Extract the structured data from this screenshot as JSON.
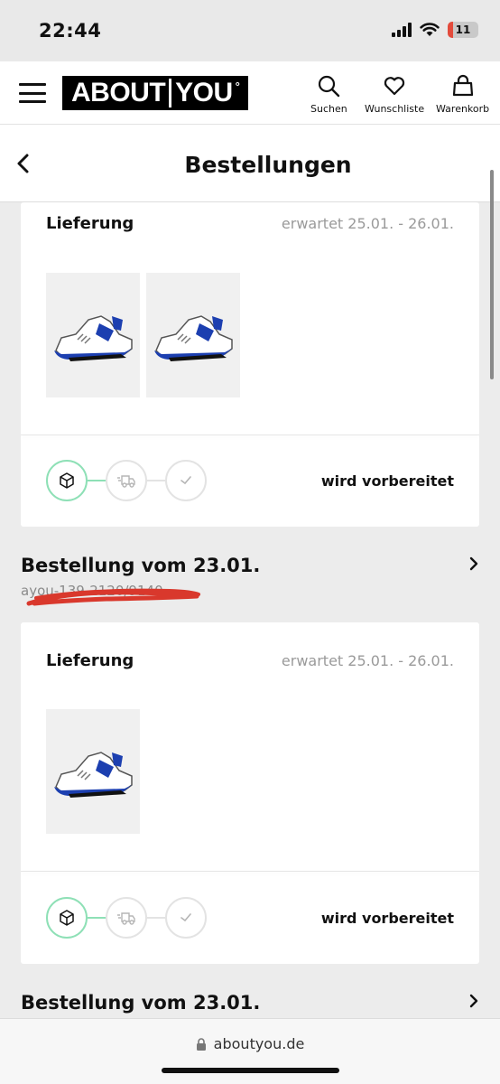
{
  "status_bar": {
    "time": "22:44",
    "battery": "11"
  },
  "header": {
    "logo_left": "ABOUT",
    "logo_right": "YOU",
    "logo_mark": "°",
    "search_label": "Suchen",
    "wishlist_label": "Wunschliste",
    "cart_label": "Warenkorb"
  },
  "page": {
    "title": "Bestellungen"
  },
  "orders": [
    {
      "delivery_label": "Lieferung",
      "expected": "erwartet 25.01. - 26.01.",
      "status": "wird vorbereitet"
    },
    {
      "heading": "Bestellung vom 23.01.",
      "number": "ayou-139-2120/9140",
      "delivery_label": "Lieferung",
      "expected": "erwartet 25.01. - 26.01.",
      "status": "wird vorbereitet"
    },
    {
      "heading": "Bestellung vom 23.01."
    }
  ],
  "browser": {
    "url": "aboutyou.de"
  },
  "colors": {
    "accent_green": "#8ee0b6",
    "brand_black": "#000000",
    "scribble_red": "#d9382c"
  }
}
